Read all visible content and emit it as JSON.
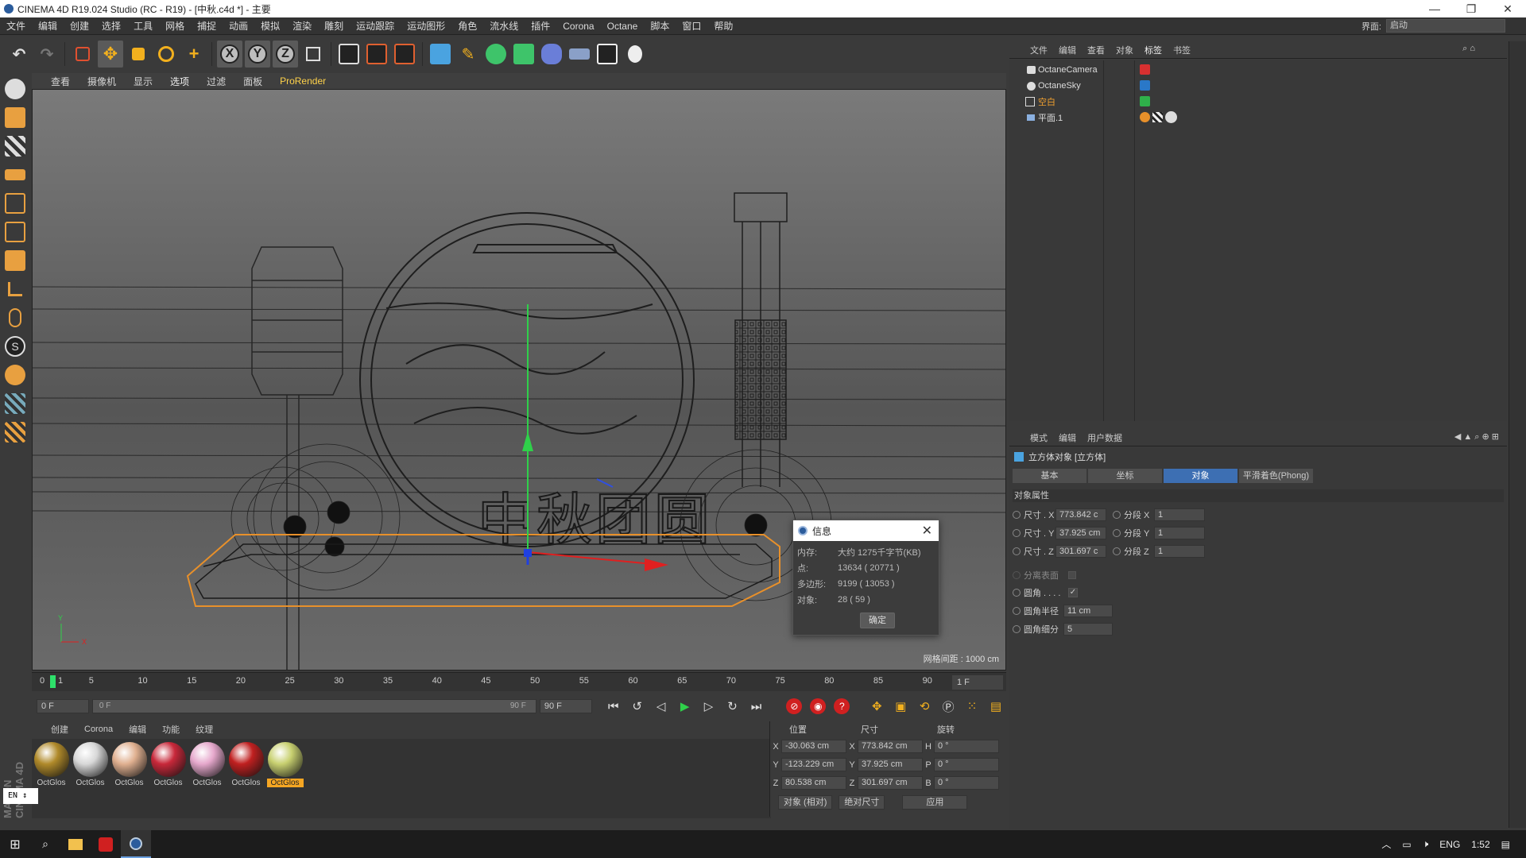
{
  "window": {
    "title": "CINEMA 4D R19.024 Studio (RC - R19) - [中秋.c4d *] - 主要",
    "buttons": [
      "—",
      "❐",
      "✕"
    ]
  },
  "menu": {
    "items": [
      "文件",
      "编辑",
      "创建",
      "选择",
      "工具",
      "网格",
      "捕捉",
      "动画",
      "模拟",
      "渲染",
      "雕刻",
      "运动跟踪",
      "运动图形",
      "角色",
      "流水线",
      "插件",
      "Corona",
      "Octane",
      "脚本",
      "窗口",
      "帮助"
    ],
    "layout_label": "界面:",
    "layout_value": "启动"
  },
  "toolbar": {
    "x_label": "X",
    "y_label": "Y",
    "z_label": "Z"
  },
  "viewport": {
    "menu": [
      "查看",
      "摄像机",
      "显示",
      "选项",
      "过滤",
      "面板",
      "ProRender"
    ],
    "grid_label": "网格间距 : 1000 cm",
    "axis_y": "Y",
    "axis_x": "X",
    "calligraphy": "中秋团圆"
  },
  "dialog": {
    "title": "信息",
    "rows": [
      {
        "k": "内存:",
        "v": "大约 1275千字节(KB)"
      },
      {
        "k": "点:",
        "v": "13634 ( 20771 )"
      },
      {
        "k": "多边形:",
        "v": "9199 ( 13053 )"
      },
      {
        "k": "对象:",
        "v": "28 ( 59 )"
      }
    ],
    "ok": "确定"
  },
  "timeline": {
    "ticks": [
      "0",
      "5",
      "10",
      "15",
      "20",
      "25",
      "30",
      "35",
      "40",
      "45",
      "50",
      "55",
      "60",
      "65",
      "70",
      "75",
      "80",
      "85",
      "90"
    ],
    "current_frame": "1",
    "frame_end_field": "1 F"
  },
  "transport": {
    "start": "0 F",
    "range_left": "0 F",
    "range_right": "90 F",
    "end": "90 F"
  },
  "materials": {
    "menu": [
      "创建",
      "Corona",
      "编辑",
      "功能",
      "纹理"
    ],
    "items": [
      {
        "label": "OctGlos",
        "color": "#b08a2a"
      },
      {
        "label": "OctGlos",
        "color": "#d8d8d8"
      },
      {
        "label": "OctGlos",
        "color": "#e0b090"
      },
      {
        "label": "OctGlos",
        "color": "#c8283a"
      },
      {
        "label": "OctGlos",
        "color": "#e6a8cc"
      },
      {
        "label": "OctGlos",
        "color": "#c02020"
      },
      {
        "label": "OctGlos",
        "color": "#c8d070"
      }
    ],
    "selected_index": 6
  },
  "coords": {
    "headers": [
      "位置",
      "尺寸",
      "旋转"
    ],
    "rows": [
      {
        "a": "X",
        "pos": "-30.063 cm",
        "b": "X",
        "size": "773.842 cm",
        "c": "H",
        "rot": "0 °"
      },
      {
        "a": "Y",
        "pos": "-123.229 cm",
        "b": "Y",
        "size": "37.925 cm",
        "c": "P",
        "rot": "0 °"
      },
      {
        "a": "Z",
        "pos": "80.538 cm",
        "b": "Z",
        "size": "301.697 cm",
        "c": "B",
        "rot": "0 °"
      }
    ],
    "mode": "对象 (相对)",
    "size_mode": "绝对尺寸",
    "apply": "应用"
  },
  "objects": {
    "menu": [
      "文件",
      "编辑",
      "查看",
      "对象",
      "标签",
      "书签"
    ],
    "active_menu": "标签",
    "items": [
      {
        "name": "OctaneCamera",
        "orange": false
      },
      {
        "name": "OctaneSky",
        "orange": false
      },
      {
        "name": "空白",
        "orange": true
      },
      {
        "name": "平面.1",
        "orange": false
      }
    ]
  },
  "attributes": {
    "menu": [
      "模式",
      "编辑",
      "用户数据"
    ],
    "title": "立方体对象 [立方体]",
    "tabs": [
      "基本",
      "坐标",
      "对象",
      "平滑着色(Phong)"
    ],
    "active_tab": "对象",
    "section": "对象属性",
    "rows": [
      {
        "label": "尺寸 . X",
        "value": "773.842 c",
        "seg_label": "分段 X",
        "seg": "1"
      },
      {
        "label": "尺寸 . Y",
        "value": "37.925 cm",
        "seg_label": "分段 Y",
        "seg": "1"
      },
      {
        "label": "尺寸 . Z",
        "value": "301.697 c",
        "seg_label": "分段 Z",
        "seg": "1"
      }
    ],
    "separate": "分离表面",
    "fillet": "圆角 . . . .",
    "fillet_checked": "✓",
    "fillet_radius_label": "圆角半径",
    "fillet_radius": "11 cm",
    "fillet_sub_label": "圆角细分",
    "fillet_sub": "5"
  },
  "sidebar_left": {
    "logo": "MAXON CINEMA 4D",
    "lang": "EN"
  },
  "taskbar": {
    "lang": "ENG",
    "time": "1:52"
  }
}
